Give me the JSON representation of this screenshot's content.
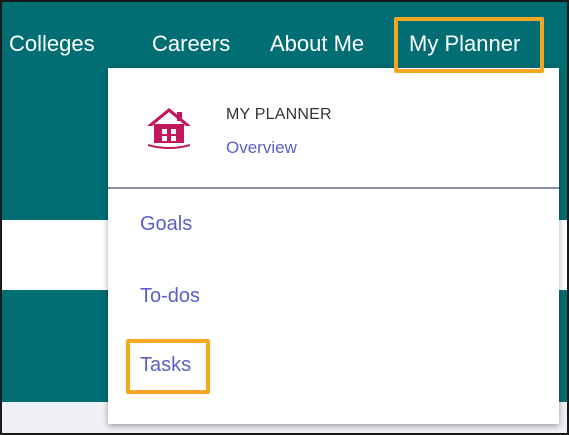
{
  "nav": {
    "items": [
      {
        "label": "Colleges"
      },
      {
        "label": "Careers"
      },
      {
        "label": "About Me"
      },
      {
        "label": "My Planner"
      }
    ]
  },
  "dropdown": {
    "heading": "MY PLANNER",
    "overview_link": "Overview",
    "icon": "house-icon",
    "links": [
      {
        "label": "Goals"
      },
      {
        "label": "To-dos"
      },
      {
        "label": "Tasks"
      }
    ]
  },
  "colors": {
    "nav_background": "#006e73",
    "link_color": "#5b5fc7",
    "highlight": "#f5a623",
    "icon_color": "#c2185b"
  }
}
